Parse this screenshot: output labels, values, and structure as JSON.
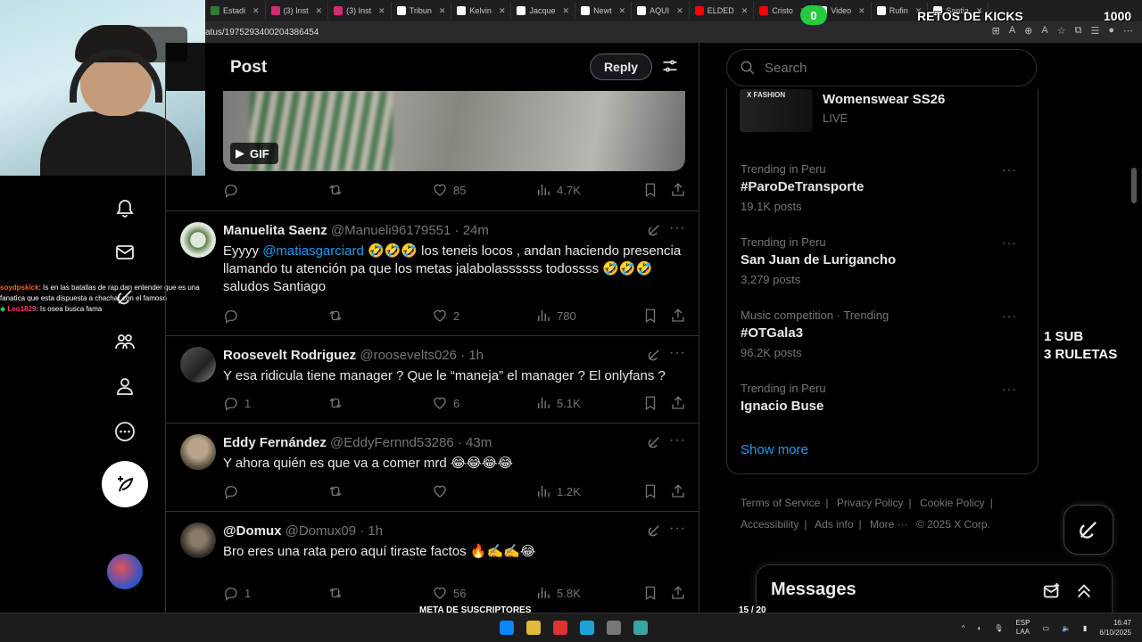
{
  "browser": {
    "tabs": [
      {
        "label": "Estadi",
        "color": "#2e7d32"
      },
      {
        "label": "(3) Inst",
        "color": "#d62976"
      },
      {
        "label": "(3) Inst",
        "color": "#d62976"
      },
      {
        "label": "Tribun",
        "color": "#ffffff"
      },
      {
        "label": "Kelvin",
        "color": "#ffffff"
      },
      {
        "label": "Jacque",
        "color": "#ffffff"
      },
      {
        "label": "Newt",
        "color": "#ffffff"
      },
      {
        "label": "AQUI",
        "color": "#ffffff"
      },
      {
        "label": "ELDED",
        "color": "#ff0000"
      },
      {
        "label": "Cristo",
        "color": "#ff0000"
      },
      {
        "label": "Video",
        "color": "#ffffff"
      },
      {
        "label": "Rufin",
        "color": "#ffffff"
      },
      {
        "label": "Santia",
        "color": "#ffffff"
      }
    ],
    "url": "atus/1975293400204386454"
  },
  "nav": {
    "icons": [
      "bell-icon",
      "mail-icon",
      "grok-icon",
      "communities-icon",
      "profile-icon",
      "more-icon"
    ]
  },
  "chat": [
    {
      "user": "soydpskick",
      "msg": ": Is en las batallas de rap dan entender que es una fanatica que esta dispuesta a chachar con el famoso"
    },
    {
      "user": "Leo1829",
      "msg": ": Is osea busca fama"
    }
  ],
  "header": {
    "title": "Post",
    "reply_label": "Reply"
  },
  "gif": {
    "badge": "GIF"
  },
  "top_actions": {
    "replies": "",
    "reposts": "",
    "likes": "85",
    "views": "4.7K"
  },
  "tweets": [
    {
      "name": "Manuelita Saenz",
      "handle": "@Manueli96179551",
      "time": "· 24m",
      "body_pre": "Eyyyy ",
      "mention": "@matiasgarciard",
      "body_post": " 🤣🤣🤣 los teneis locos , andan haciendo presencia llamando tu atención pa que los metas jalabolassssss todossss 🤣🤣🤣 saludos Santiago",
      "replies": "",
      "reposts": "",
      "likes": "2",
      "views": "780"
    },
    {
      "name": "Roosevelt Rodriguez",
      "handle": "@roosevelts026",
      "time": "· 1h",
      "body_pre": "Y esa ridicula tiene manager ? Que le “maneja” el manager ? El onlyfans ?",
      "mention": "",
      "body_post": "",
      "replies": "1",
      "reposts": "",
      "likes": "6",
      "views": "5.1K"
    },
    {
      "name": "Eddy Fernández",
      "handle": "@EddyFernnd53286",
      "time": "· 43m",
      "body_pre": "Y ahora quién es que va a comer mrd 😂😂😂😂",
      "mention": "",
      "body_post": "",
      "replies": "",
      "reposts": "",
      "likes": "",
      "views": "1.2K"
    },
    {
      "name": "@Domux",
      "handle": "@Domux09",
      "time": "· 1h",
      "body_pre": "Bro eres una rata pero aquí tiraste factos 🔥✍️✍️😂",
      "mention": "",
      "body_post": "",
      "replies": "1",
      "reposts": "",
      "likes": "56",
      "views": "5.8K"
    }
  ],
  "search": {
    "placeholder": "Search"
  },
  "live": {
    "brand": "X FASHION",
    "title": "Womenswear SS26",
    "status": "LIVE"
  },
  "trends": [
    {
      "context": "Trending in Peru",
      "title": "#ParoDeTransporte",
      "count": "19.1K posts"
    },
    {
      "context": "Trending in Peru",
      "title": "San Juan de Lurigancho",
      "count": "3,279 posts"
    },
    {
      "context": "Music competition · Trending",
      "title": "#OTGala3",
      "count": "96.2K posts"
    },
    {
      "context": "Trending in Peru",
      "title": "Ignacio Buse",
      "count": ""
    }
  ],
  "show_more": "Show more",
  "footer": {
    "links": [
      "Terms of Service",
      "Privacy Policy",
      "Cookie Policy",
      "Accessibility",
      "Ads info",
      "More ···"
    ],
    "copyright": "© 2025 X Corp."
  },
  "messages": {
    "title": "Messages"
  },
  "overlay": {
    "goal_count": "0",
    "retos": "RETOS DE KICKS",
    "retos_num": "1000",
    "sub_line1": "1 SUB",
    "sub_line2": "3 RULETAS",
    "meta_label": "META DE SUSCRIPTORES",
    "meta_count": "15 / 20",
    "meta_progress": 0.75
  },
  "taskbar": {
    "lang1": "ESP",
    "lang2": "LAA",
    "time": "16:47",
    "date": "6/10/2025"
  },
  "colors": {
    "accent": "#1d9bf0",
    "muted": "#71767b",
    "goal": "#27c93f"
  }
}
